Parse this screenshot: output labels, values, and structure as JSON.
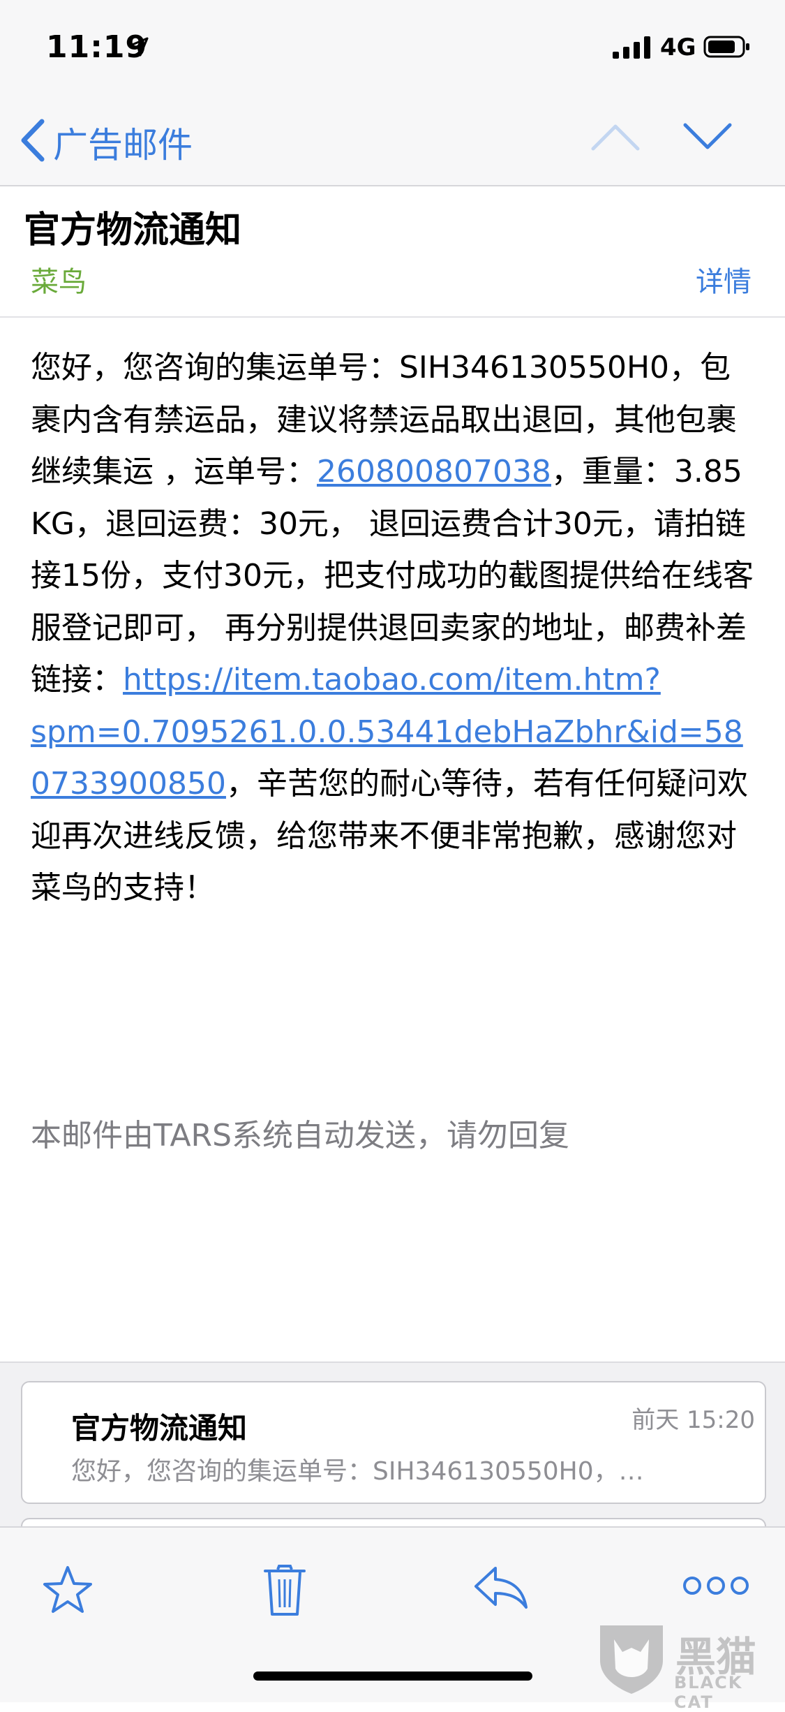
{
  "status_bar": {
    "time": "11:19",
    "network": "4G"
  },
  "nav": {
    "back_label": "广告邮件"
  },
  "email": {
    "subject": "官方物流通知",
    "sender": "菜鸟",
    "details_label": "详情",
    "body_p1": "您好，您咨询的集运单号：SIH346130550H0，包裹内含有禁运品，建议将禁运品取出退回，其他包裹继续集运 ，运单号：",
    "tracking_link": "260800807038",
    "body_p2": "，重量：3.85 KG，退回运费：30元， 退回运费合计30元，请拍链接15份，支付30元，把支付成功的截图提供给在线客服登记即可， 再分别提供退回卖家的地址，邮费补差链接：",
    "payment_link": "https://item.taobao.com/item.htm?spm=0.7095261.0.0.53441debHaZbhr&id=580733900850",
    "body_p3": "，辛苦您的耐心等待，若有任何疑问欢迎再次进线反馈，给您带来不便非常抱歉，感谢您对菜鸟的支持！",
    "footer": "本邮件由TARS系统自动发送，请勿回复"
  },
  "thread": {
    "subject": "官方物流通知",
    "time": "前天 15:20",
    "snippet": "您好，您咨询的集运单号：SIH346130550H0，…"
  },
  "toolbar": {
    "icons": [
      "star-icon",
      "trash-icon",
      "reply-icon",
      "more-icon"
    ]
  },
  "watermark": {
    "text_cn": "黑猫",
    "text_en": "BLACK CAT"
  },
  "colors": {
    "accent": "#3b7ddd",
    "sender": "#6aaa3a",
    "muted": "#8e8e93"
  }
}
